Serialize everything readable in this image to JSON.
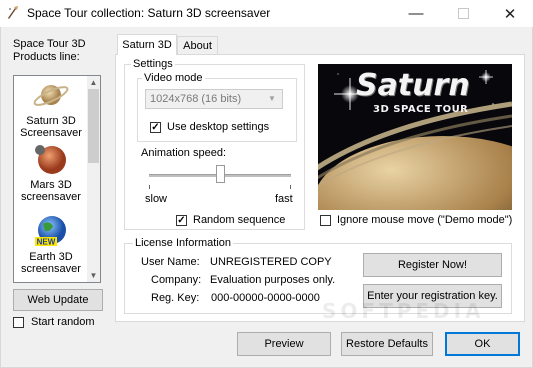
{
  "window": {
    "title": "Space Tour collection:  Saturn 3D screensaver"
  },
  "left_panel": {
    "label_line1": "Space Tour 3D",
    "label_line2": "Products line:",
    "products": [
      {
        "line1": "Saturn 3D",
        "line2": "Screensaver"
      },
      {
        "line1": "Mars 3D",
        "line2": "screensaver"
      },
      {
        "line1": "Earth 3D",
        "line2": "screensaver",
        "badge": "NEW"
      }
    ],
    "web_update_label": "Web Update",
    "start_random_label": "Start random"
  },
  "tabs": [
    {
      "label": "Saturn 3D"
    },
    {
      "label": "About"
    }
  ],
  "settings": {
    "group_label": "Settings",
    "video_mode": {
      "label": "Video mode",
      "selected": "1024x768 (16 bits)",
      "use_desktop_label": "Use desktop settings",
      "use_desktop_checked": true
    },
    "animation_speed": {
      "label": "Animation speed:",
      "min_label": "slow",
      "max_label": "fast",
      "value": 0.5
    },
    "random_sequence_label": "Random sequence",
    "random_sequence_checked": true
  },
  "preview": {
    "title": "Saturn",
    "subtitle": "3D SPACE TOUR",
    "ignore_mouse_label": "Ignore mouse move (\"Demo mode\")",
    "ignore_mouse_checked": false
  },
  "license": {
    "group_label": "License Information",
    "user_name_label": "User Name:",
    "user_name_value": "UNREGISTERED COPY",
    "company_label": "Company:",
    "company_value": "Evaluation purposes only.",
    "reg_key_label": "Reg. Key:",
    "reg_key_value": "000-00000-0000-0000",
    "register_label": "Register Now!",
    "enter_key_label": "Enter your registration key."
  },
  "bottom": {
    "preview_label": "Preview",
    "restore_label": "Restore Defaults",
    "ok_label": "OK"
  },
  "watermark": "SOFTPEDIA",
  "colors": {
    "accent": "#0078d7",
    "button_face": "#e1e1e1",
    "window_bg": "#f0f0f0"
  }
}
